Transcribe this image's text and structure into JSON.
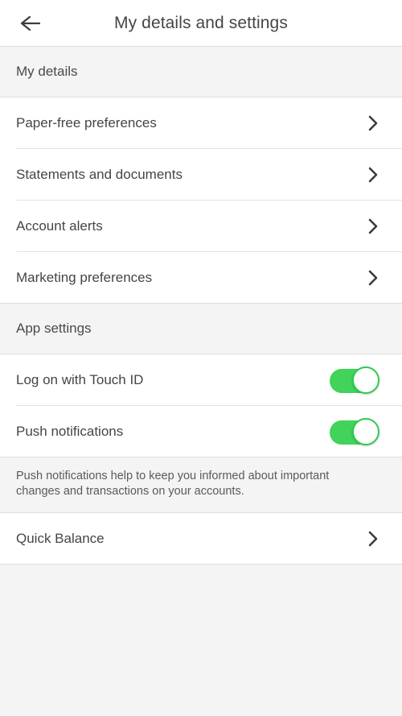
{
  "header": {
    "title": "My details and settings",
    "back_icon": "arrow-left-icon"
  },
  "sections": [
    {
      "id": "my-details",
      "title": "My details",
      "rows": [
        {
          "label": "Paper-free preferences",
          "type": "link",
          "icon": "chevron-right-icon"
        },
        {
          "label": "Statements and documents",
          "type": "link",
          "icon": "chevron-right-icon"
        },
        {
          "label": "Account alerts",
          "type": "link",
          "icon": "chevron-right-icon"
        },
        {
          "label": "Marketing preferences",
          "type": "link",
          "icon": "chevron-right-icon"
        }
      ]
    },
    {
      "id": "app-settings",
      "title": "App settings",
      "rows": [
        {
          "label": "Log on with Touch ID",
          "type": "toggle",
          "value": "on"
        },
        {
          "label": "Push notifications",
          "type": "toggle",
          "value": "on"
        }
      ],
      "note": "Push notifications help to keep you informed about important changes and transactions on your accounts.",
      "rows_after_note": [
        {
          "label": "Quick Balance",
          "type": "link",
          "icon": "chevron-right-icon"
        }
      ]
    }
  ],
  "colors": {
    "toggle_on_track": "#41d35a",
    "toggle_on_ring": "#2ecc4e",
    "page_background": "#f4f4f4",
    "row_background": "#ffffff",
    "text_primary": "#454545",
    "text_secondary": "#5a5a5a",
    "divider": "#e3e3e3"
  }
}
